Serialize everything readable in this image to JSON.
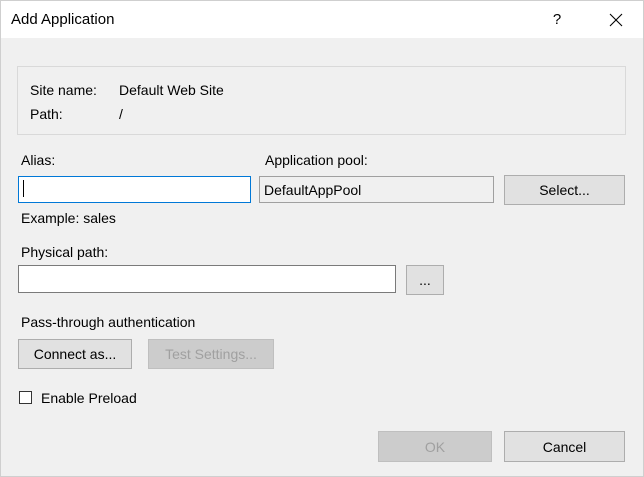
{
  "window": {
    "title": "Add Application",
    "help_glyph": "?"
  },
  "site_info": {
    "site_name_label": "Site name:",
    "site_name_value": "Default Web Site",
    "path_label": "Path:",
    "path_value": "/"
  },
  "alias": {
    "label": "Alias:",
    "value": "",
    "example": "Example: sales"
  },
  "app_pool": {
    "label": "Application pool:",
    "value": "DefaultAppPool",
    "select_label": "Select..."
  },
  "physical_path": {
    "label": "Physical path:",
    "value": "",
    "browse_label": "..."
  },
  "auth": {
    "label": "Pass-through authentication",
    "connect_label": "Connect as...",
    "test_label": "Test Settings..."
  },
  "preload": {
    "label": "Enable Preload",
    "checked": false
  },
  "footer": {
    "ok_label": "OK",
    "cancel_label": "Cancel"
  }
}
